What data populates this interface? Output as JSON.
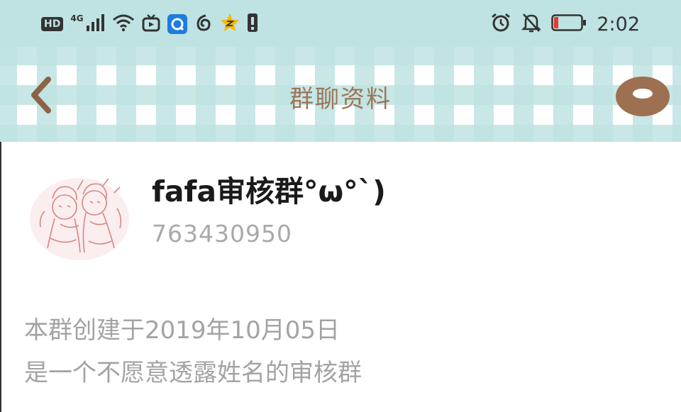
{
  "status_bar": {
    "network_type": "4G",
    "hd_label": "HD",
    "time": "2:02",
    "icons": [
      "hd-icon",
      "signal-icon",
      "wifi-icon",
      "tv-icon",
      "browser-app-icon",
      "netease-icon",
      "qzone-icon",
      "notification-icon",
      "alarm-icon",
      "mute-icon",
      "battery-icon"
    ],
    "battery_level": 0.12,
    "battery_color": "#e53935"
  },
  "nav": {
    "title": "群聊资料",
    "back_icon": "chevron-left-icon",
    "more_icon": "donut-icon",
    "accent_color": "#9c7658"
  },
  "group": {
    "name": "fafa审核群°ω°`)",
    "id": "763430950",
    "description_lines": [
      "本群创建于2019年10月05日",
      "是一个不愿意透露姓名的审核群"
    ]
  }
}
